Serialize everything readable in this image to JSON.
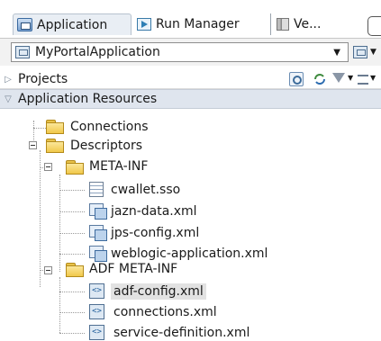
{
  "tabs": [
    {
      "label": "Application",
      "icon": "application-icon",
      "active": true
    },
    {
      "label": "Run Manager",
      "icon": "run-manager-icon",
      "active": false
    },
    {
      "label": "Ve...",
      "icon": "versioning-icon",
      "active": false
    }
  ],
  "application_selector": {
    "value": "MyPortalApplication",
    "icon": "application-workspace-icon",
    "arrow": "▼"
  },
  "panels": {
    "projects": {
      "label": "Projects",
      "collapsed": true
    },
    "application_resources": {
      "label": "Application Resources",
      "collapsed": false
    }
  },
  "tree": {
    "connections": "Connections",
    "descriptors": "Descriptors",
    "meta_inf": {
      "label": "META-INF",
      "files": [
        "cwallet.sso",
        "jazn-data.xml",
        "jps-config.xml",
        "weblogic-application.xml"
      ]
    },
    "adf_meta_inf": {
      "label": "ADF META-INF",
      "files": [
        "adf-config.xml",
        "connections.xml",
        "service-definition.xml"
      ],
      "selected": "adf-config.xml"
    }
  },
  "colors": {
    "section_header": "#dfe5ee",
    "selection": "#e2e2e2",
    "folder": "#f1c84a"
  }
}
